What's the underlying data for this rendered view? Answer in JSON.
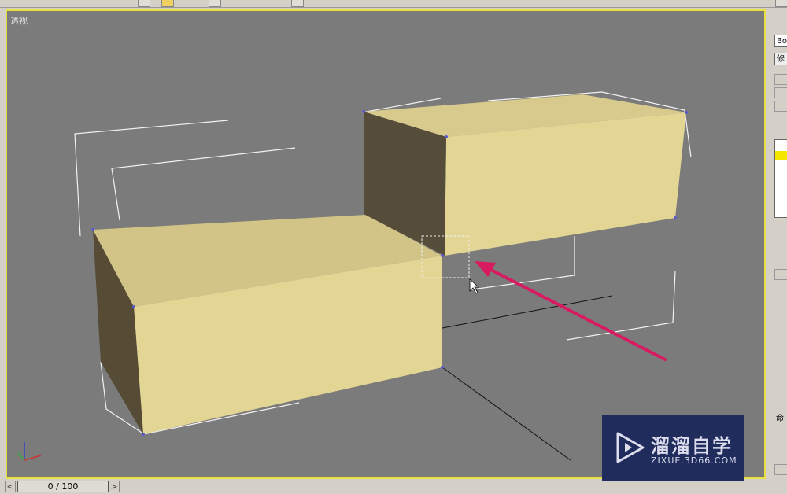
{
  "viewport": {
    "label": "透视"
  },
  "command_panel": {
    "object_name": "Bo",
    "modifier_list": "修",
    "command_label": "命"
  },
  "timeline": {
    "frame": "0 / 100",
    "prev": "<",
    "next": ">"
  },
  "watermark": {
    "title": "溜溜自学",
    "url": "ZIXUE.3D66.COM"
  },
  "colors": {
    "viewport_border": "#e8e040",
    "box_color": "#e3d594",
    "arrow": "#d81b60",
    "background": "#7b7b7b"
  }
}
